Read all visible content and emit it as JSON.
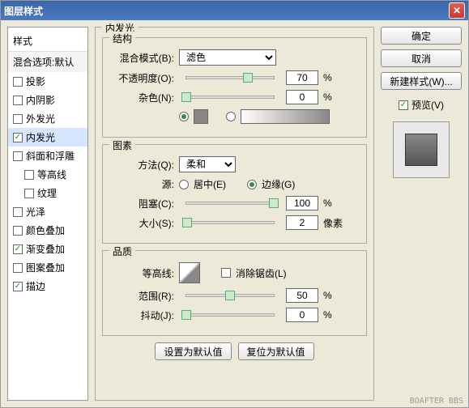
{
  "title": "图层样式",
  "left": {
    "header": "样式",
    "blend": "混合选项:默认",
    "items": [
      {
        "label": "投影",
        "checked": false,
        "indent": 0
      },
      {
        "label": "内阴影",
        "checked": false,
        "indent": 0
      },
      {
        "label": "外发光",
        "checked": false,
        "indent": 0
      },
      {
        "label": "内发光",
        "checked": true,
        "indent": 0,
        "sel": true
      },
      {
        "label": "斜面和浮雕",
        "checked": false,
        "indent": 0
      },
      {
        "label": "等高线",
        "checked": false,
        "indent": 1
      },
      {
        "label": "纹理",
        "checked": false,
        "indent": 1
      },
      {
        "label": "光泽",
        "checked": false,
        "indent": 0
      },
      {
        "label": "颜色叠加",
        "checked": false,
        "indent": 0
      },
      {
        "label": "渐变叠加",
        "checked": true,
        "indent": 0
      },
      {
        "label": "图案叠加",
        "checked": false,
        "indent": 0
      },
      {
        "label": "描边",
        "checked": true,
        "indent": 0
      }
    ]
  },
  "main": {
    "group_title": "内发光",
    "struct": {
      "legend": "结构",
      "blend_mode_label": "混合模式(B):",
      "blend_mode_value": "滤色",
      "opacity_label": "不透明度(O):",
      "opacity_value": "70",
      "percent": "%",
      "noise_label": "杂色(N):",
      "noise_value": "0"
    },
    "elem": {
      "legend": "图素",
      "method_label": "方法(Q):",
      "method_value": "柔和",
      "source_label": "源:",
      "center": "居中(E)",
      "edge": "边缘(G)",
      "choke_label": "阻塞(C):",
      "choke_value": "100",
      "size_label": "大小(S):",
      "size_value": "2",
      "px": "像素"
    },
    "qual": {
      "legend": "品质",
      "contour_label": "等高线:",
      "anti_alias": "消除锯齿(L)",
      "range_label": "范围(R):",
      "range_value": "50",
      "jitter_label": "抖动(J):",
      "jitter_value": "0"
    },
    "make_default": "设置为默认值",
    "reset_default": "复位为默认值"
  },
  "right": {
    "ok": "确定",
    "cancel": "取消",
    "new_style": "新建样式(W)...",
    "preview": "预览(V)"
  },
  "watermark": "BOAFTER BBS"
}
